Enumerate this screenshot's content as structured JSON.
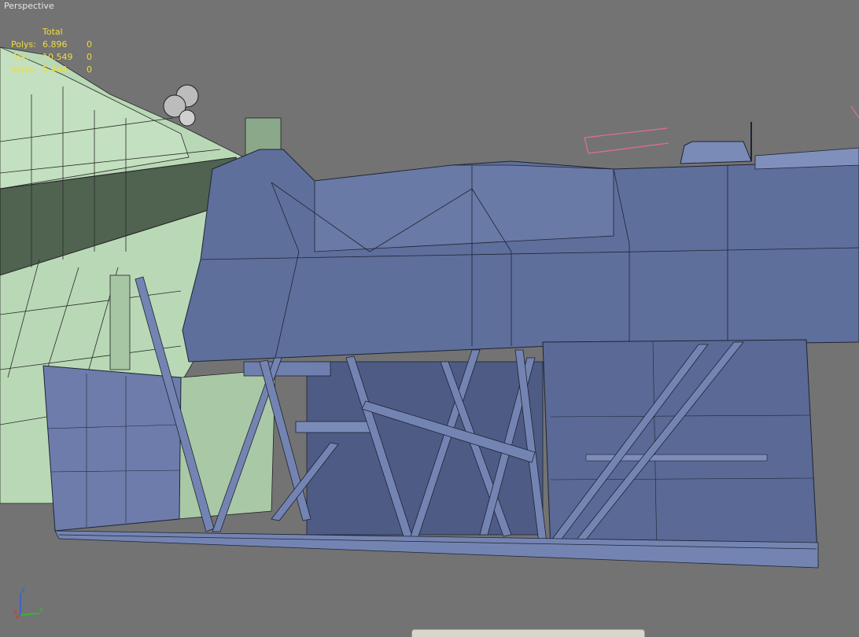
{
  "viewport": {
    "label": "Perspective",
    "background": "#737373"
  },
  "stats": {
    "header": "Total",
    "color": "#f0dc3c",
    "rows": [
      {
        "label": "Polys:",
        "total": "6.896",
        "selected": "0"
      },
      {
        "label": "Tris:",
        "total": "10.549",
        "selected": "0"
      },
      {
        "label": "Verts:",
        "total": "5.444",
        "selected": "0"
      }
    ]
  },
  "axis_gizmo": {
    "x": "x",
    "y": "y",
    "z": "z",
    "colors": {
      "x": "#e03030",
      "y": "#30c030",
      "z": "#3060e0"
    }
  },
  "model_colors": {
    "hull_blue": "#5f6f9c",
    "hull_dark": "#404d73",
    "frame_green": "#bcdcbc",
    "frame_dark_green": "#4f6350"
  }
}
